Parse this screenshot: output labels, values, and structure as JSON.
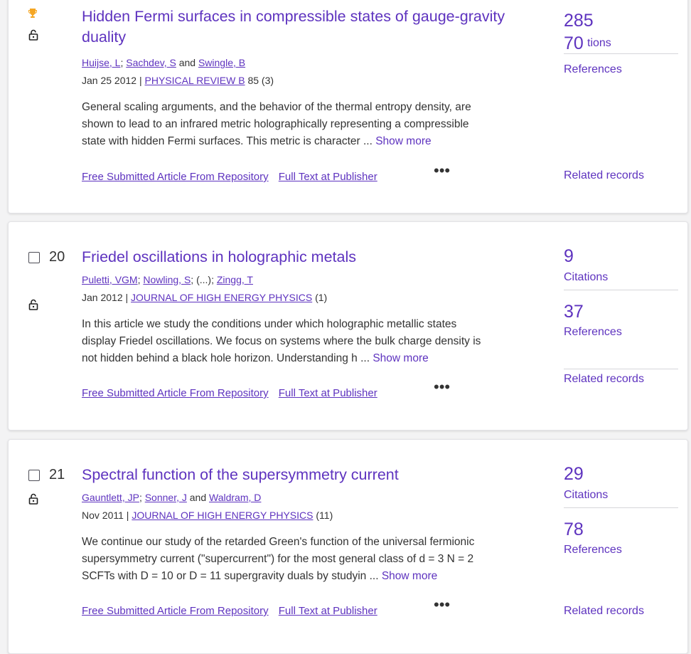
{
  "colors": {
    "accent": "#5e33bf",
    "text": "#333333",
    "trophy": "#f5a623"
  },
  "records": [
    {
      "number": "",
      "title": "Hidden Fermi surfaces in compressible states of gauge-gravity duality",
      "title_line1": "Hidden Fermi surfaces in compressible states of gauge-gravity",
      "title_line2": "duality",
      "authors": [
        {
          "name": "Huijse, L",
          "sep": "; "
        },
        {
          "name": "Sachdev, S",
          "sep": " and "
        },
        {
          "name": "Swingle, B",
          "sep": ""
        }
      ],
      "date": "Jan 25 2012",
      "journal": "PHYSICAL REVIEW B",
      "volume": "85 (3)",
      "abstract_lines": [
        "General scaling arguments, and the behavior of the thermal entropy density, are",
        "shown to lead to an infrared metric holographically representing a compressible",
        "state with hidden Fermi surfaces. This metric is character ..."
      ],
      "show_more": "Show more",
      "link_repo": "Free Submitted Article From Repository",
      "link_publisher": "Full Text at Publisher",
      "citations": "285",
      "citations_label": "tions",
      "references": "70",
      "references_label": "References",
      "related": "Related records"
    },
    {
      "number": "20",
      "title": "Friedel oscillations in holographic metals",
      "authors_text": [
        {
          "name": "Puletti, VGM",
          "sep": "; "
        },
        {
          "name": "Nowling, S",
          "sep": "; (...); "
        },
        {
          "name": "Zingg, T",
          "sep": ""
        }
      ],
      "date": "Jan 2012",
      "journal": "JOURNAL OF HIGH ENERGY PHYSICS",
      "volume": "(1)",
      "abstract_lines": [
        "In this article we study the conditions under which holographic metallic states",
        "display Friedel oscillations. We focus on systems where the bulk charge density is",
        "not hidden behind a black hole horizon. Understanding h ..."
      ],
      "show_more": "Show more",
      "link_repo": "Free Submitted Article From Repository",
      "link_publisher": "Full Text at Publisher",
      "citations": "9",
      "citations_label": "Citations",
      "references": "37",
      "references_label": "References",
      "related": "Related records"
    },
    {
      "number": "21",
      "title": "Spectral function of the supersymmetry current",
      "authors_text": [
        {
          "name": "Gauntlett, JP",
          "sep": "; "
        },
        {
          "name": "Sonner, J",
          "sep": " and "
        },
        {
          "name": "Waldram, D",
          "sep": ""
        }
      ],
      "date": "Nov 2011",
      "journal": "JOURNAL OF HIGH ENERGY PHYSICS",
      "volume": "(11)",
      "abstract_lines": [
        "We continue our study of the retarded Green's function of the universal fermionic",
        "supersymmetry current (\"supercurrent\") for the most general class of d = 3 N = 2",
        "SCFTs with D = 10 or D = 11 supergravity duals by studyin ..."
      ],
      "show_more": "Show more",
      "link_repo": "Free Submitted Article From Repository",
      "link_publisher": "Full Text at Publisher",
      "citations": "29",
      "citations_label": "Citations",
      "references": "78",
      "references_label": "References",
      "related": "Related records"
    }
  ],
  "icons": {
    "more": "more-options-icon",
    "lock": "open-access-lock-icon",
    "trophy": "highly-cited-trophy-icon"
  },
  "glyphs": {
    "dots": "•••",
    "date_sep": " | "
  }
}
